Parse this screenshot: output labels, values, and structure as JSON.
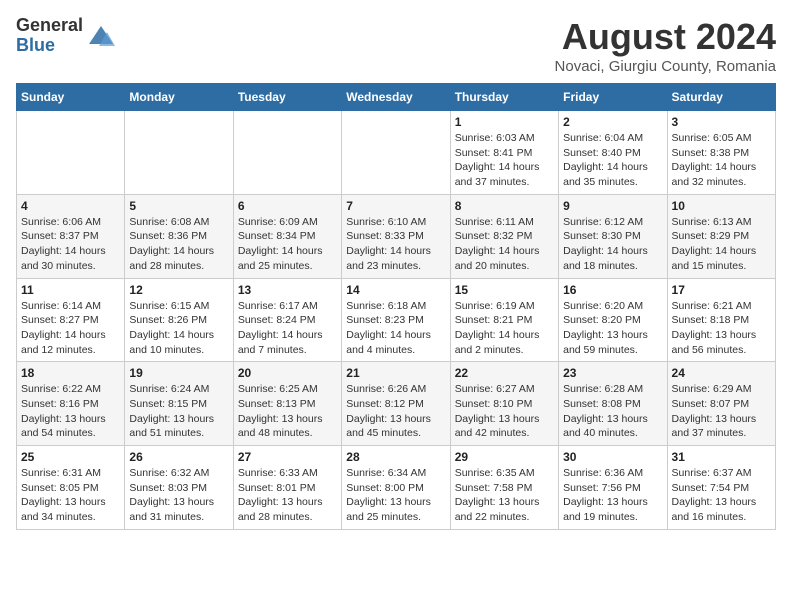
{
  "header": {
    "logo_general": "General",
    "logo_blue": "Blue",
    "month_title": "August 2024",
    "location": "Novaci, Giurgiu County, Romania"
  },
  "days_of_week": [
    "Sunday",
    "Monday",
    "Tuesday",
    "Wednesday",
    "Thursday",
    "Friday",
    "Saturday"
  ],
  "weeks": [
    [
      null,
      null,
      null,
      null,
      {
        "day": "1",
        "sunrise": "6:03 AM",
        "sunset": "8:41 PM",
        "daylight": "14 hours and 37 minutes."
      },
      {
        "day": "2",
        "sunrise": "6:04 AM",
        "sunset": "8:40 PM",
        "daylight": "14 hours and 35 minutes."
      },
      {
        "day": "3",
        "sunrise": "6:05 AM",
        "sunset": "8:38 PM",
        "daylight": "14 hours and 32 minutes."
      }
    ],
    [
      {
        "day": "4",
        "sunrise": "6:06 AM",
        "sunset": "8:37 PM",
        "daylight": "14 hours and 30 minutes."
      },
      {
        "day": "5",
        "sunrise": "6:08 AM",
        "sunset": "8:36 PM",
        "daylight": "14 hours and 28 minutes."
      },
      {
        "day": "6",
        "sunrise": "6:09 AM",
        "sunset": "8:34 PM",
        "daylight": "14 hours and 25 minutes."
      },
      {
        "day": "7",
        "sunrise": "6:10 AM",
        "sunset": "8:33 PM",
        "daylight": "14 hours and 23 minutes."
      },
      {
        "day": "8",
        "sunrise": "6:11 AM",
        "sunset": "8:32 PM",
        "daylight": "14 hours and 20 minutes."
      },
      {
        "day": "9",
        "sunrise": "6:12 AM",
        "sunset": "8:30 PM",
        "daylight": "14 hours and 18 minutes."
      },
      {
        "day": "10",
        "sunrise": "6:13 AM",
        "sunset": "8:29 PM",
        "daylight": "14 hours and 15 minutes."
      }
    ],
    [
      {
        "day": "11",
        "sunrise": "6:14 AM",
        "sunset": "8:27 PM",
        "daylight": "14 hours and 12 minutes."
      },
      {
        "day": "12",
        "sunrise": "6:15 AM",
        "sunset": "8:26 PM",
        "daylight": "14 hours and 10 minutes."
      },
      {
        "day": "13",
        "sunrise": "6:17 AM",
        "sunset": "8:24 PM",
        "daylight": "14 hours and 7 minutes."
      },
      {
        "day": "14",
        "sunrise": "6:18 AM",
        "sunset": "8:23 PM",
        "daylight": "14 hours and 4 minutes."
      },
      {
        "day": "15",
        "sunrise": "6:19 AM",
        "sunset": "8:21 PM",
        "daylight": "14 hours and 2 minutes."
      },
      {
        "day": "16",
        "sunrise": "6:20 AM",
        "sunset": "8:20 PM",
        "daylight": "13 hours and 59 minutes."
      },
      {
        "day": "17",
        "sunrise": "6:21 AM",
        "sunset": "8:18 PM",
        "daylight": "13 hours and 56 minutes."
      }
    ],
    [
      {
        "day": "18",
        "sunrise": "6:22 AM",
        "sunset": "8:16 PM",
        "daylight": "13 hours and 54 minutes."
      },
      {
        "day": "19",
        "sunrise": "6:24 AM",
        "sunset": "8:15 PM",
        "daylight": "13 hours and 51 minutes."
      },
      {
        "day": "20",
        "sunrise": "6:25 AM",
        "sunset": "8:13 PM",
        "daylight": "13 hours and 48 minutes."
      },
      {
        "day": "21",
        "sunrise": "6:26 AM",
        "sunset": "8:12 PM",
        "daylight": "13 hours and 45 minutes."
      },
      {
        "day": "22",
        "sunrise": "6:27 AM",
        "sunset": "8:10 PM",
        "daylight": "13 hours and 42 minutes."
      },
      {
        "day": "23",
        "sunrise": "6:28 AM",
        "sunset": "8:08 PM",
        "daylight": "13 hours and 40 minutes."
      },
      {
        "day": "24",
        "sunrise": "6:29 AM",
        "sunset": "8:07 PM",
        "daylight": "13 hours and 37 minutes."
      }
    ],
    [
      {
        "day": "25",
        "sunrise": "6:31 AM",
        "sunset": "8:05 PM",
        "daylight": "13 hours and 34 minutes."
      },
      {
        "day": "26",
        "sunrise": "6:32 AM",
        "sunset": "8:03 PM",
        "daylight": "13 hours and 31 minutes."
      },
      {
        "day": "27",
        "sunrise": "6:33 AM",
        "sunset": "8:01 PM",
        "daylight": "13 hours and 28 minutes."
      },
      {
        "day": "28",
        "sunrise": "6:34 AM",
        "sunset": "8:00 PM",
        "daylight": "13 hours and 25 minutes."
      },
      {
        "day": "29",
        "sunrise": "6:35 AM",
        "sunset": "7:58 PM",
        "daylight": "13 hours and 22 minutes."
      },
      {
        "day": "30",
        "sunrise": "6:36 AM",
        "sunset": "7:56 PM",
        "daylight": "13 hours and 19 minutes."
      },
      {
        "day": "31",
        "sunrise": "6:37 AM",
        "sunset": "7:54 PM",
        "daylight": "13 hours and 16 minutes."
      }
    ]
  ]
}
